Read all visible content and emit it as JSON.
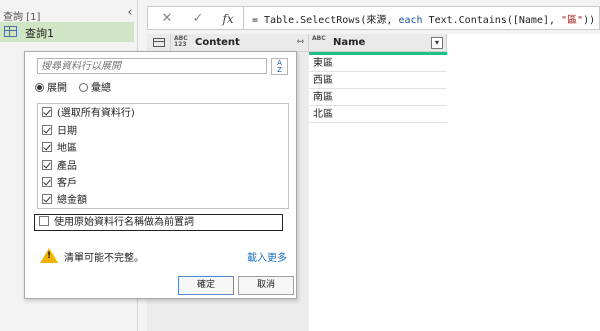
{
  "queries": {
    "title": "查詢 [1]",
    "collapse_icon": "‹",
    "items": [
      {
        "label": "查詢1"
      }
    ]
  },
  "formula_bar": {
    "cancel_icon": "✕",
    "commit_icon": "✓",
    "fx_label": "fx",
    "formula_prefix": "= Table.SelectRows(來源, ",
    "formula_keyword": "each",
    "formula_mid": " Text.Contains([Name], ",
    "formula_string": "\"區\"",
    "formula_suffix": "))"
  },
  "grid": {
    "columns": [
      {
        "name": "Content",
        "type_icon": "ABC\n123",
        "header_icon": "⇿"
      },
      {
        "name": "Name",
        "type_icon": "ABC",
        "header_icon": "▾"
      }
    ],
    "rows": [
      "東區",
      "西區",
      "南區",
      "北區"
    ],
    "accent_color": "#1fbf86"
  },
  "dropdown": {
    "search_placeholder": "搜尋資料行以展開",
    "sort_icon": "A↓Z",
    "radio_expand": "展開",
    "radio_aggregate": "彙總",
    "selected_mode": "expand",
    "columns": [
      {
        "label": "(選取所有資料行)",
        "checked": true
      },
      {
        "label": "日期",
        "checked": true
      },
      {
        "label": "地區",
        "checked": true
      },
      {
        "label": "產品",
        "checked": true
      },
      {
        "label": "客戶",
        "checked": true
      },
      {
        "label": "總金額",
        "checked": true
      }
    ],
    "prefix_option": "使用原始資料行名稱做為前置詞",
    "prefix_checked": false,
    "warning_icon": "warning-icon",
    "warning_text": "清單可能不完整。",
    "load_more": "載入更多",
    "ok_label": "確定",
    "cancel_label": "取消"
  }
}
